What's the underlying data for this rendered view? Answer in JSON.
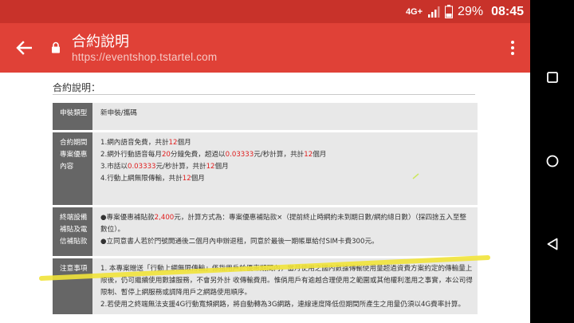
{
  "status_bar": {
    "network": "4G+",
    "battery": "29%",
    "time": "08:45"
  },
  "app_bar": {
    "title": "合約說明",
    "url": "https://eventshop.tstartel.com"
  },
  "page": {
    "section_title": "合約說明：",
    "rows": [
      {
        "label": "申裝類型",
        "lines": [
          [
            {
              "t": "新申裝/攜碼"
            }
          ]
        ]
      },
      {
        "label": "合約期間專案優惠內容",
        "lines": [
          [
            {
              "t": "1.網內語音免費，共計"
            },
            {
              "t": "12",
              "red": true
            },
            {
              "t": "個月"
            }
          ],
          [
            {
              "t": "2.網外行動語音每月"
            },
            {
              "t": "20",
              "red": true
            },
            {
              "t": "分鐘免費，超過以"
            },
            {
              "t": "0.03333",
              "red": true
            },
            {
              "t": "元/秒計算，共計"
            },
            {
              "t": "12",
              "red": true
            },
            {
              "t": "個月"
            }
          ],
          [
            {
              "t": "3.市話以"
            },
            {
              "t": "0.03333",
              "red": true
            },
            {
              "t": "元/秒計算，共計"
            },
            {
              "t": "12",
              "red": true
            },
            {
              "t": "個月"
            }
          ],
          [
            {
              "t": "4.行動上網無限傳輸，共計"
            },
            {
              "t": "12",
              "red": true
            },
            {
              "t": "個月"
            }
          ]
        ]
      },
      {
        "label": "終端設備補貼及電信補貼款",
        "lines": [
          [
            {
              "t": "●專案優惠補貼款"
            },
            {
              "t": "2,400",
              "red": true
            },
            {
              "t": "元，計算方式為：專案優惠補貼款×（提前終止時網約未到期日數/網約總日數）（採四捨五入至整數位）。"
            }
          ],
          [
            {
              "t": "●立同意書人若於門號開通後二個月內申辦退租，同意於最後一期帳單給付SIM卡費300元。"
            }
          ]
        ]
      },
      {
        "label": "注意事項",
        "lines": [
          [
            {
              "t": "1. 本專案贈送「行動上網無限傳輸」係指用戶於優惠期間內，當月使用之國內數據傳輸使用量超過資費方案約定的傳輸量上限後，仍可繼續使用數據服務，不會另外計 收傳輸費用。惟倘用戶有逾越合理使用之範圍或其他權利濫用之事實，本公司得限制、暫停上網服務或調降用戶之網路使用順序。"
            }
          ],
          [
            {
              "t": "2.若使用之終端無法支援4G行動寬頻網路，將自動轉為3G網路，連線速度降低但期間所產生之用量仍須以4G費率計算。"
            }
          ]
        ]
      }
    ]
  },
  "colors": {
    "status_bar": "#c8322a",
    "app_bar": "#e04137",
    "label_cell": "#666666",
    "value_cell": "#e8e8e8",
    "highlight": "#f1e33a"
  }
}
